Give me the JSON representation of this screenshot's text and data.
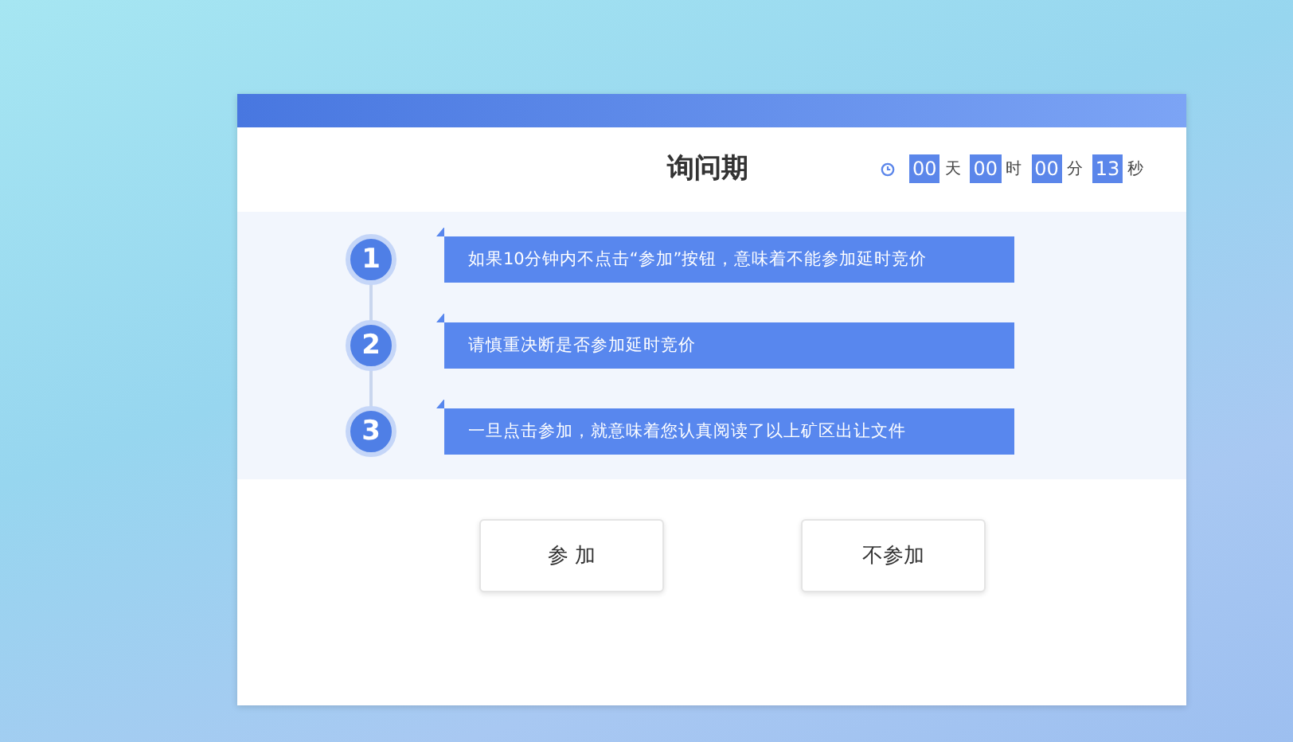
{
  "dialog": {
    "title": "询问期",
    "countdown": [
      {
        "value": "00",
        "unit": "天"
      },
      {
        "value": "00",
        "unit": "时"
      },
      {
        "value": "00",
        "unit": "分"
      },
      {
        "value": "13",
        "unit": "秒"
      }
    ],
    "steps": [
      {
        "number": "1",
        "text": "如果10分钟内不点击“参加”按钮，意味着不能参加延时竞价"
      },
      {
        "number": "2",
        "text": "请慎重决断是否参加延时竞价"
      },
      {
        "number": "3",
        "text": "一旦点击参加，就意味着您认真阅读了以上矿区出让文件"
      }
    ],
    "buttons": [
      {
        "label": "参 加"
      },
      {
        "label": "不参加"
      }
    ]
  }
}
